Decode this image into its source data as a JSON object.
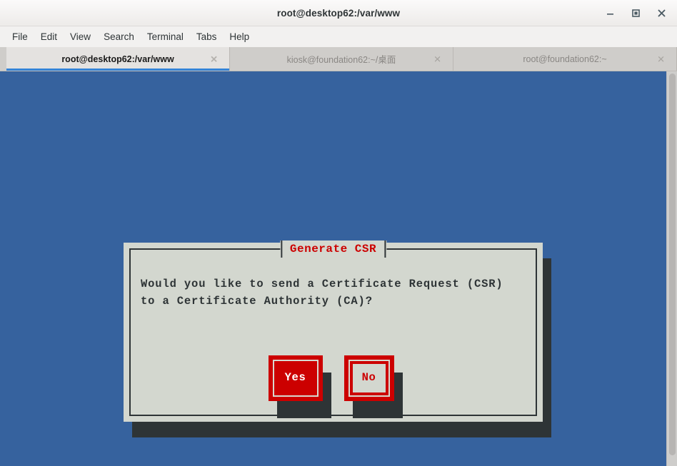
{
  "window": {
    "title": "root@desktop62:/var/www",
    "controls": [
      {
        "name": "minimize",
        "glyph": "–"
      },
      {
        "name": "maximize",
        "glyph": "□"
      },
      {
        "name": "close",
        "glyph": "✕"
      }
    ]
  },
  "menubar": {
    "items": [
      {
        "label": "File"
      },
      {
        "label": "Edit"
      },
      {
        "label": "View"
      },
      {
        "label": "Search"
      },
      {
        "label": "Terminal"
      },
      {
        "label": "Tabs"
      },
      {
        "label": "Help"
      }
    ]
  },
  "tabs": [
    {
      "label": "root@desktop62:/var/www",
      "active": true,
      "close_glyph": "✕"
    },
    {
      "label": "kiosk@foundation62:~/桌面",
      "active": false,
      "close_glyph": "✕"
    },
    {
      "label": "root@foundation62:~",
      "active": false,
      "close_glyph": "✕"
    }
  ],
  "terminal": {
    "background_color": "#36629e"
  },
  "dialog": {
    "title": "Generate CSR",
    "message_lines": [
      "Would you like to send a Certificate Request (CSR)",
      "to a Certificate Authority (CA)?"
    ],
    "background_color": "#d3d7cf",
    "accent_color": "#cc0000",
    "border_color": "#2e3436",
    "buttons": [
      {
        "label": "Yes",
        "state": "focused"
      },
      {
        "label": "No",
        "state": "unfocused"
      }
    ]
  }
}
